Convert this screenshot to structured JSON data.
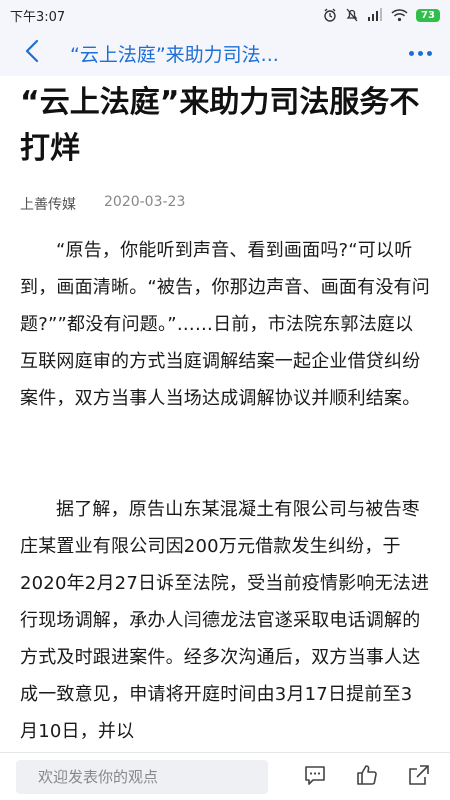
{
  "status_bar": {
    "time": "下午3:07",
    "battery": "73"
  },
  "nav": {
    "title": "“云上法庭”来助力司法..."
  },
  "article": {
    "title": "“云上法庭”来助力司法服务不打烊",
    "source": "上善传媒",
    "date": "2020-03-23",
    "paragraphs": [
      "“原告，你能听到声音、看到画面吗?“可以听到，画面清晰。“被告，你那边声音、画面有没有问题?””都没有问题。”……日前，市法院东郭法庭以互联网庭审的方式当庭调解结案一起企业借贷纠纷案件，双方当事人当场达成调解协议并顺利结案。",
      "据了解，原告山东某混凝土有限公司与被告枣庄某置业有限公司因200万元借款发生纠纷，于2020年2月27日诉至法院，受当前疫情影响无法进行现场调解，承办人闫德龙法官遂采取电话调解的方式及时跟进案件。经多次沟通后，双方当事人达成一致意见，申请将开庭时间由3月17日提前至3月10日，并以"
    ]
  },
  "bottom_bar": {
    "comment_placeholder": "欢迎发表你的观点"
  }
}
